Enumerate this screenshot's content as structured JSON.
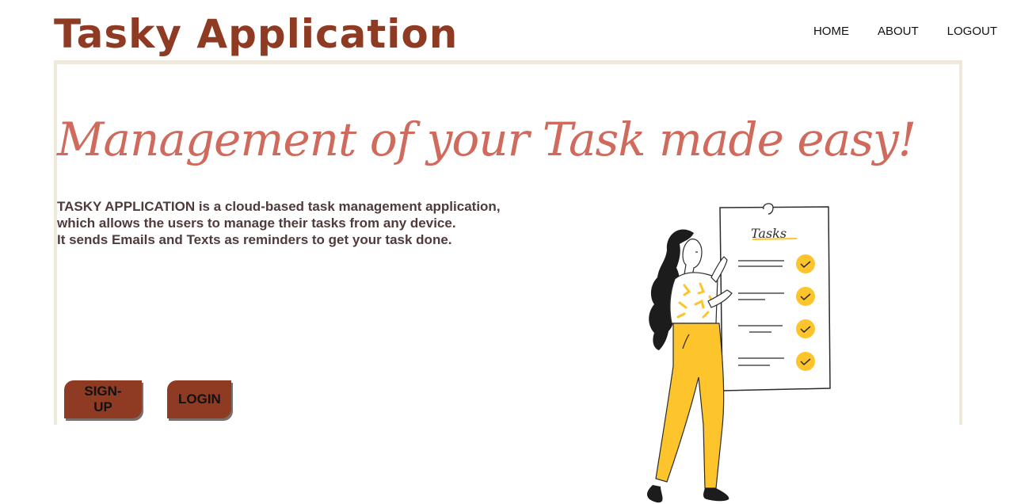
{
  "header": {
    "app_title": "Tasky Application",
    "nav": {
      "home": "HOME",
      "about": "ABOUT",
      "logout": "LOGOUT"
    }
  },
  "hero": {
    "headline": "Management of your Task made easy!",
    "description_lines": [
      "TASKY APPLICATION is a cloud-based task management application,",
      "which allows the users to manage their tasks from any device.",
      "It sends Emails and Texts as reminders to get your task done."
    ],
    "buttons": {
      "signup": "SIGN-UP",
      "login": "LOGIN"
    }
  },
  "illustration": {
    "board_title": "Tasks",
    "icon": "woman-holding-task-list-illustration"
  },
  "colors": {
    "brand": "#8f3b24",
    "headline": "#cf6a5c",
    "text": "#4f3b3b",
    "panel_border": "#efe9dc",
    "check": "#fdc42b"
  }
}
